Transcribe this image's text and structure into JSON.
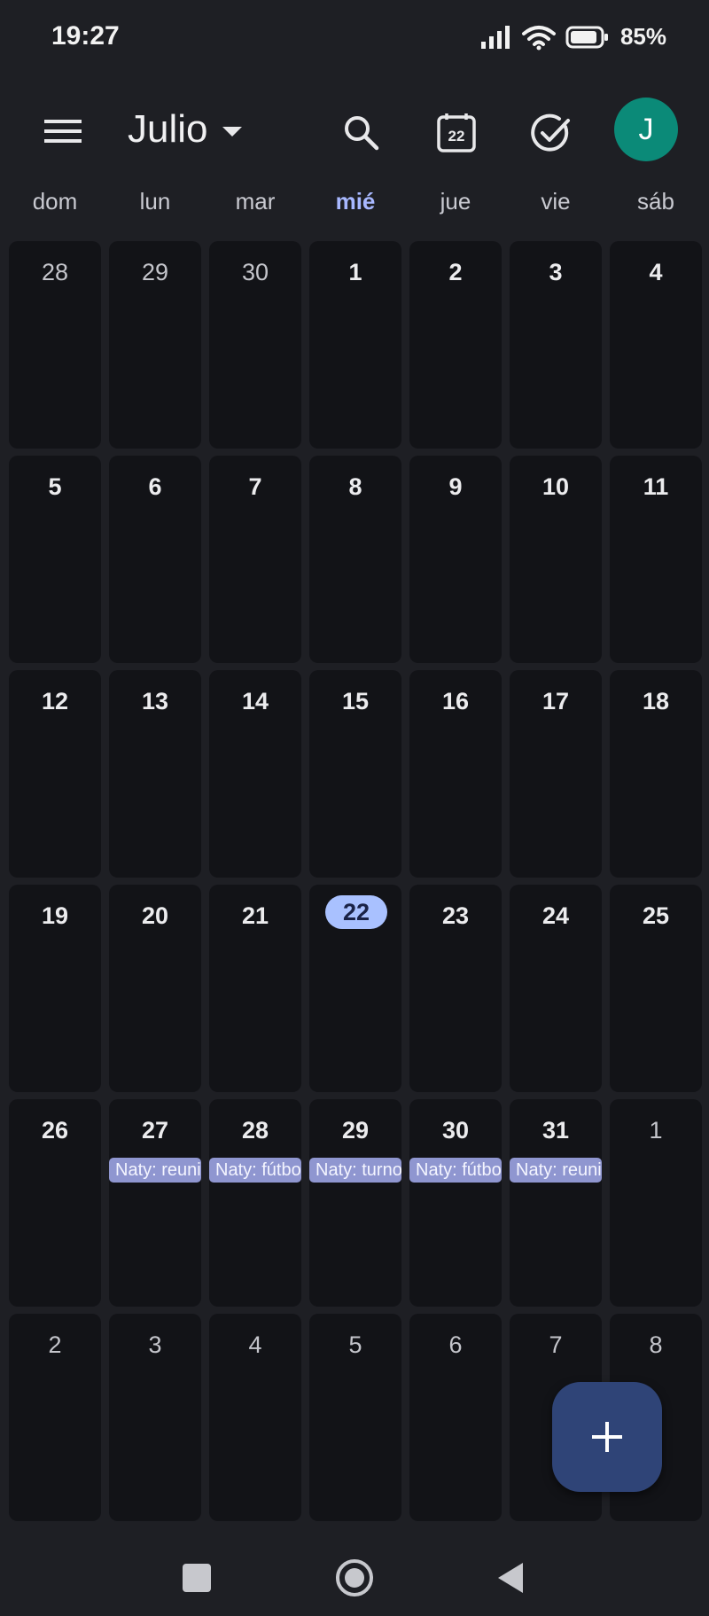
{
  "status_bar": {
    "time": "19:27",
    "battery": "85%"
  },
  "header": {
    "month": "Julio",
    "today_icon_day": "22",
    "avatar_letter": "J"
  },
  "weekdays": [
    "dom",
    "lun",
    "mar",
    "mié",
    "jue",
    "vie",
    "sáb"
  ],
  "weeks": [
    [
      "28",
      "29",
      "30",
      "1",
      "2",
      "3",
      "4"
    ],
    [
      "5",
      "6",
      "7",
      "8",
      "9",
      "10",
      "11"
    ],
    [
      "12",
      "13",
      "14",
      "15",
      "16",
      "17",
      "18"
    ],
    [
      "19",
      "20",
      "21",
      "22",
      "23",
      "24",
      "25"
    ],
    [
      "26",
      "27",
      "28",
      "29",
      "30",
      "31",
      "1"
    ],
    [
      "2",
      "3",
      "4",
      "5",
      "6",
      "7",
      "8"
    ]
  ],
  "events": [
    "Naty: reunión",
    "Naty: fútbol",
    "Naty: turno",
    "Naty: fútbol",
    "Naty: reunión"
  ],
  "colors": {
    "accent": "#a9c1ff",
    "event": "#8f96d0",
    "fab": "#2f4477",
    "avatar": "#0b8a78"
  },
  "icons": {
    "menu": "menu-icon",
    "search": "search-icon",
    "today": "calendar-today-icon",
    "tasks": "task-check-icon",
    "add": "plus-icon",
    "nav": [
      "square-icon",
      "circle-icon",
      "triangle-back-icon"
    ]
  }
}
